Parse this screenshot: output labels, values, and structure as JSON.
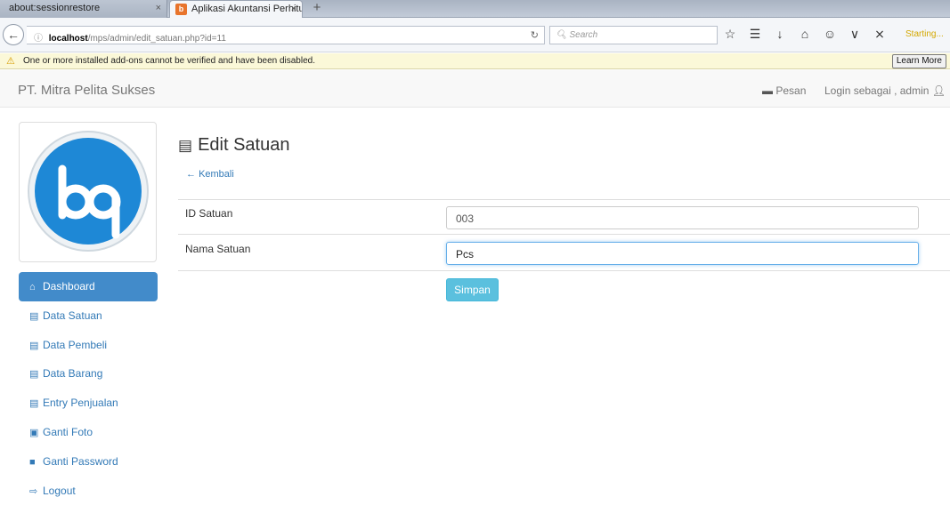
{
  "browser": {
    "tabs": [
      {
        "title": "about:sessionrestore",
        "active": false
      },
      {
        "title": "Aplikasi Akuntansi Perhitu...",
        "active": true
      }
    ],
    "close_glyph": "×",
    "newtab_glyph": "+",
    "url_host": "localhost",
    "url_path": "/mps/admin/edit_satuan.php?id=11",
    "search_placeholder": "Search",
    "status": "Starting...",
    "notification": "One or more installed add-ons cannot be verified and have been disabled.",
    "learn_more": "Learn More"
  },
  "appbar": {
    "brand": "PT. Mitra Pelita Sukses",
    "pesan": "Pesan",
    "login": "Login sebagai , admin"
  },
  "sidebar": {
    "items": [
      {
        "label": "Dashboard",
        "icon": "home-icon",
        "active": true
      },
      {
        "label": "Data Satuan",
        "icon": "briefcase-icon"
      },
      {
        "label": "Data Pembeli",
        "icon": "briefcase-icon"
      },
      {
        "label": "Data Barang",
        "icon": "briefcase-icon"
      },
      {
        "label": "Entry Penjualan",
        "icon": "briefcase-icon"
      },
      {
        "label": "Ganti Foto",
        "icon": "picture-icon"
      },
      {
        "label": "Ganti Password",
        "icon": "lock-icon"
      },
      {
        "label": "Logout",
        "icon": "logout-icon"
      }
    ]
  },
  "main": {
    "title": "Edit Satuan",
    "back": "Kembali",
    "fields": [
      {
        "label": "ID Satuan",
        "value": "003"
      },
      {
        "label": "Nama Satuan",
        "value": "Pcs"
      }
    ],
    "submit": "Simpan"
  },
  "colors": {
    "primary": "#428bca",
    "info": "#5bc0de",
    "link": "#337ab7"
  }
}
